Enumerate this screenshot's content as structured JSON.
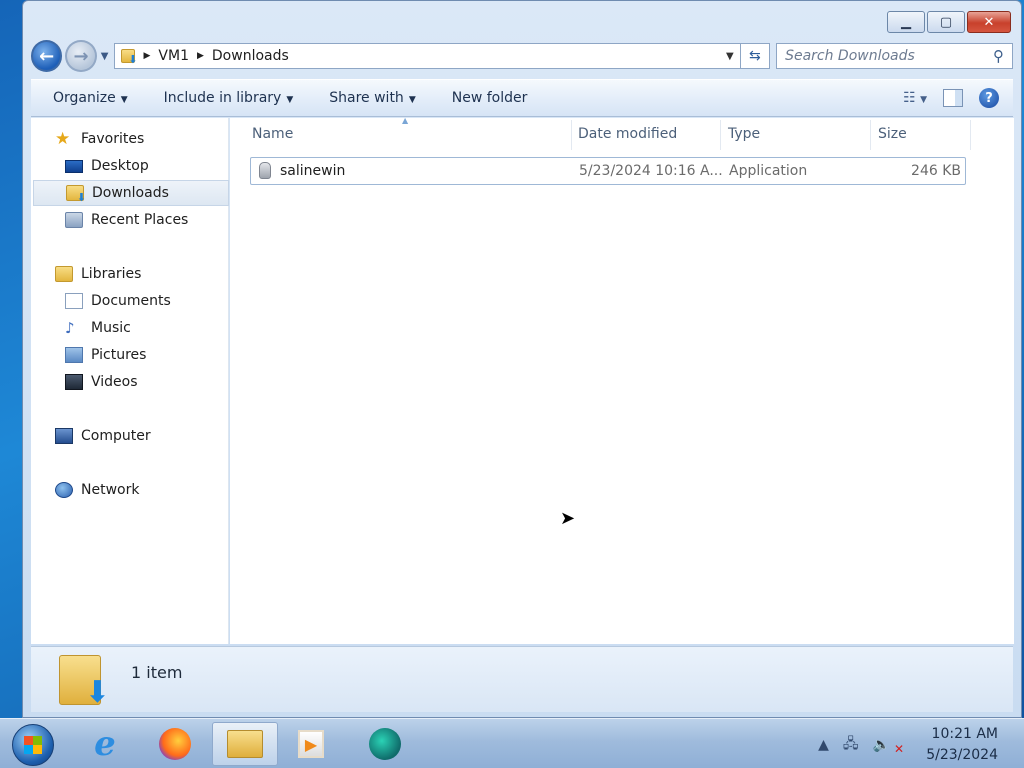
{
  "window": {
    "caption_buttons": {
      "minimize_icon": "minimize-icon",
      "maximize_icon": "maximize-icon",
      "close_icon": "close-icon"
    }
  },
  "nav": {
    "breadcrumb": [
      "VM1",
      "Downloads"
    ],
    "search_placeholder": "Search Downloads"
  },
  "toolbar": {
    "organize": "Organize",
    "include_in_library": "Include in library",
    "share_with": "Share with",
    "new_folder": "New folder"
  },
  "sidebar": {
    "favorites": {
      "label": "Favorites",
      "items": [
        {
          "label": "Desktop"
        },
        {
          "label": "Downloads",
          "selected": true
        },
        {
          "label": "Recent Places"
        }
      ]
    },
    "libraries": {
      "label": "Libraries",
      "items": [
        {
          "label": "Documents"
        },
        {
          "label": "Music"
        },
        {
          "label": "Pictures"
        },
        {
          "label": "Videos"
        }
      ]
    },
    "computer": "Computer",
    "network": "Network"
  },
  "file_list": {
    "columns": [
      "Name",
      "Date modified",
      "Type",
      "Size"
    ],
    "rows": [
      {
        "name": "salinewin",
        "date_modified": "5/23/2024 10:16 A...",
        "type": "Application",
        "size": "246 KB"
      }
    ]
  },
  "details": {
    "item_count": "1 item"
  },
  "taskbar": {
    "apps": [
      "internet-explorer",
      "firefox",
      "windows-explorer",
      "windows-media-player",
      "cyberfox"
    ],
    "active_app": "windows-explorer",
    "clock_time": "10:21 AM",
    "clock_date": "5/23/2024"
  },
  "colors": {
    "accent": "#1e5fb8",
    "selection_border": "#9fb8d6",
    "close_button": "#c8412c"
  }
}
